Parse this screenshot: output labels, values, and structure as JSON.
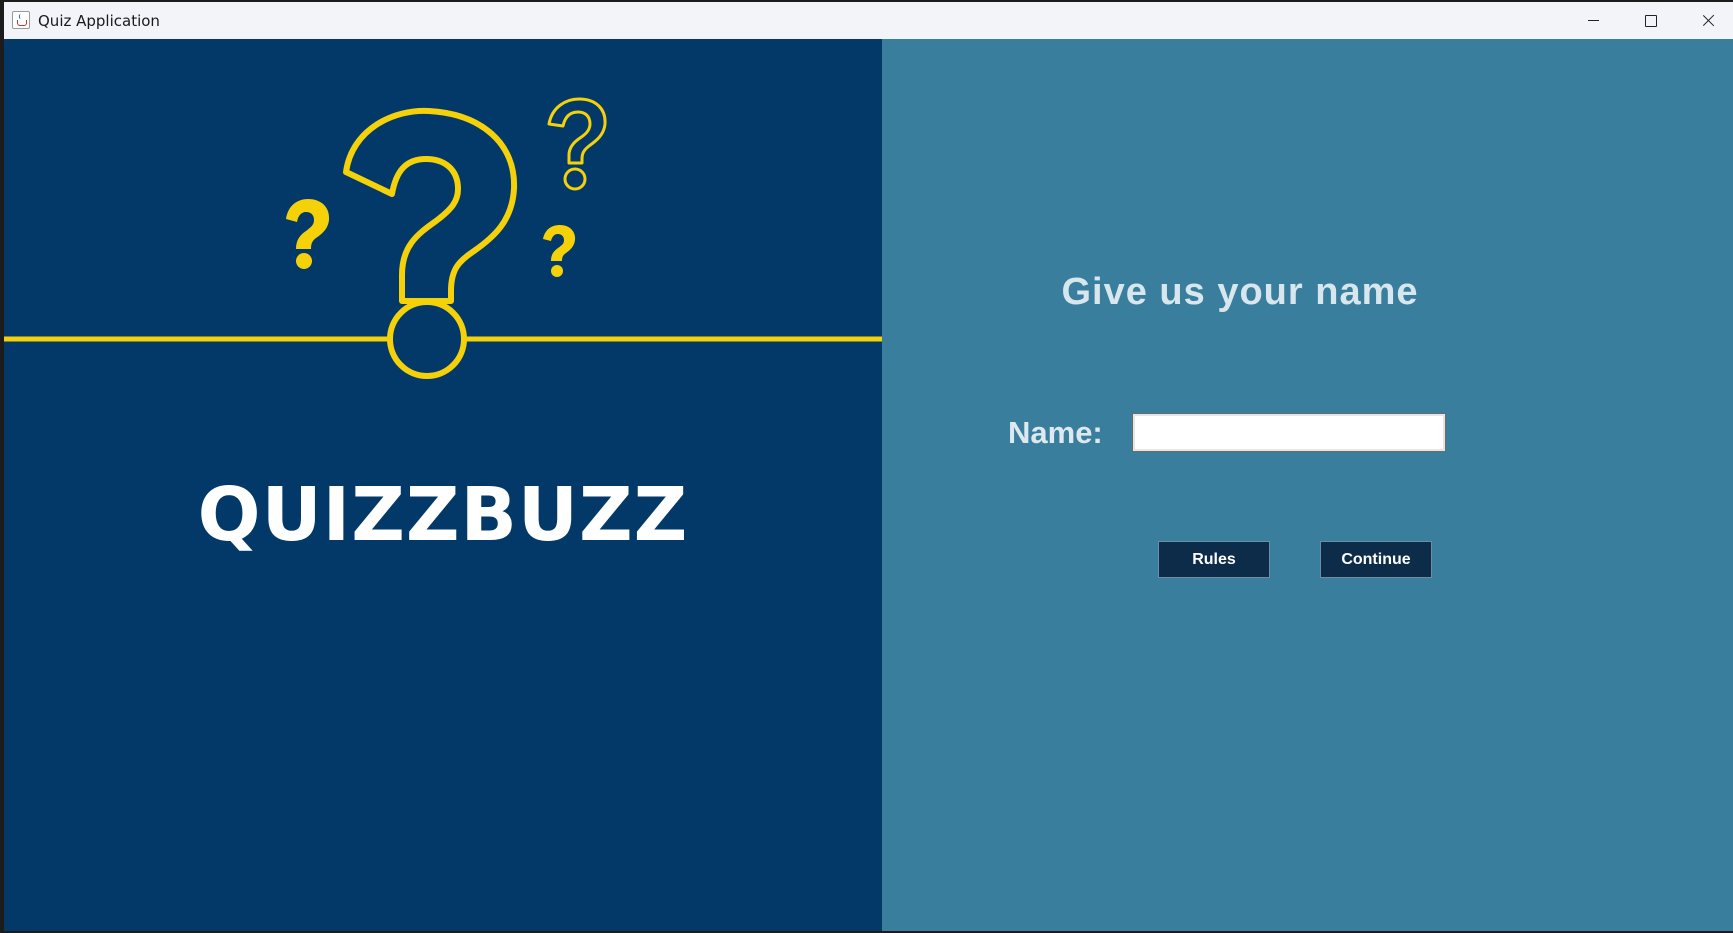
{
  "window": {
    "title": "Quiz Application",
    "controls": [
      "minimize",
      "maximize",
      "close"
    ]
  },
  "left_panel": {
    "brand": "QUIZZBUZZ",
    "background": "#023968",
    "accent": "#f5d10a"
  },
  "right_panel": {
    "background": "#3a7e9e",
    "heading": "Give us your name",
    "name_label": "Name:",
    "name_input": {
      "value": "",
      "placeholder": ""
    },
    "buttons": {
      "rules": "Rules",
      "continue": "Continue"
    }
  }
}
